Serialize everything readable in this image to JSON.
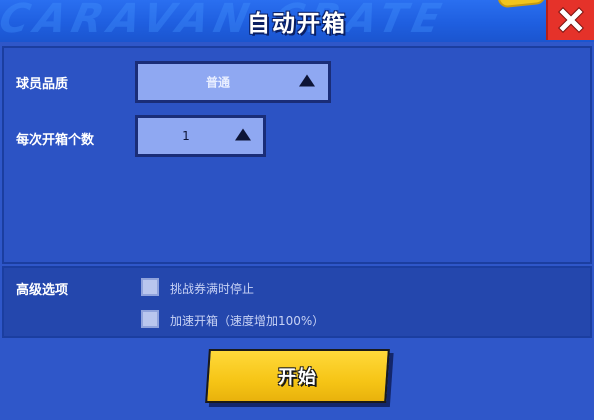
{
  "header": {
    "title": "自动开箱",
    "bg_text": "CARAVAN CRATE",
    "close_icon": "close-x-icon"
  },
  "form": {
    "quality_label": "球员品质",
    "quality_value": "普通",
    "count_label": "每次开箱个数",
    "count_value": "1",
    "arrow_icon": "triangle-up-icon"
  },
  "advanced": {
    "title": "高级选项",
    "options": [
      {
        "label": "挑战券满时停止",
        "checked": false
      },
      {
        "label": "加速开箱（速度增加100%）",
        "checked": false
      }
    ]
  },
  "start_button": {
    "label": "开始"
  },
  "colors": {
    "background": "#2f57c9",
    "header": "#1f5fe0",
    "close": "#e5322a",
    "dropdown_fill": "#8fa8f2",
    "start_button": "#f6c516"
  }
}
